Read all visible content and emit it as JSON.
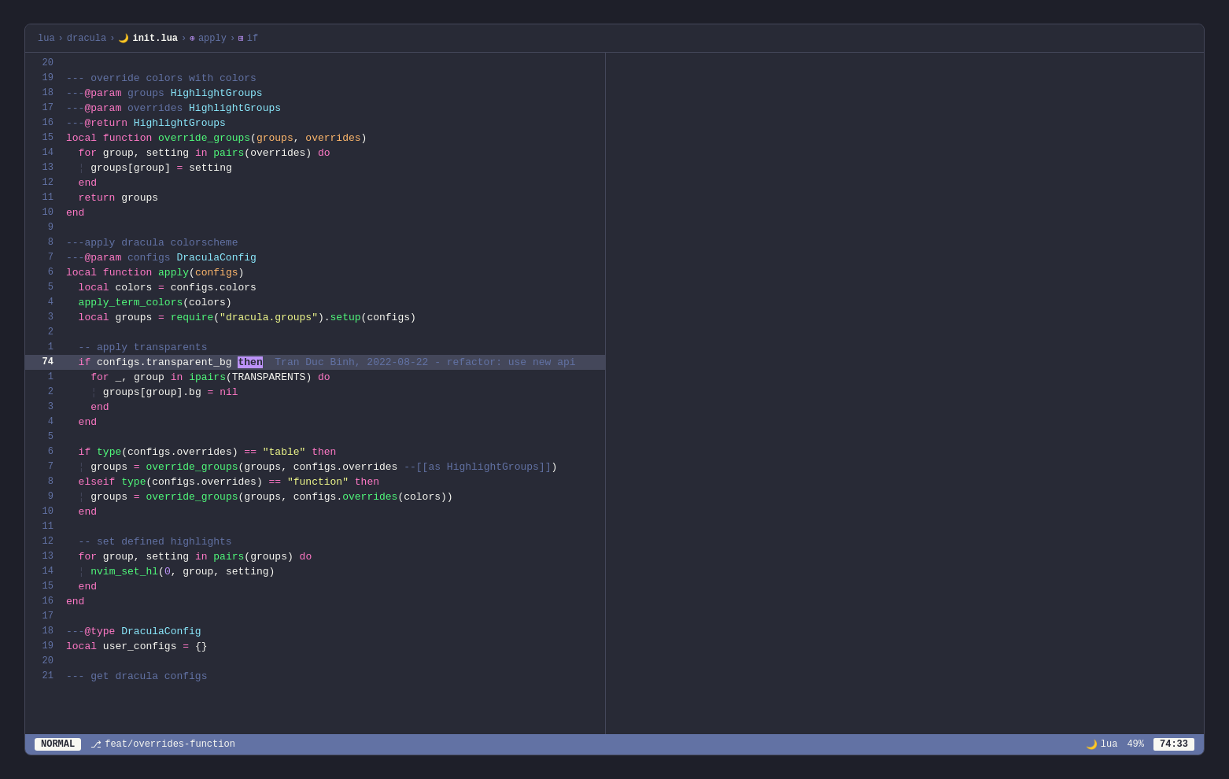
{
  "breadcrumb": {
    "parts": [
      "lua",
      "dracula",
      "init.lua",
      "apply",
      "if"
    ],
    "icons": [
      "",
      "🌙",
      "",
      "⊕",
      ""
    ]
  },
  "statusbar": {
    "mode": "NORMAL",
    "branch_icon": "⎇",
    "branch": "feat/overrides-function",
    "filename": "init.lua",
    "lang_icon": "🌙",
    "lang": "lua",
    "percent": "49%",
    "position": "74:33"
  },
  "lines": [
    {
      "num": "20",
      "content": ""
    },
    {
      "num": "19",
      "content": "--- override colors with colors"
    },
    {
      "num": "18",
      "content": "---@param groups HighlightGroups"
    },
    {
      "num": "17",
      "content": "---@param overrides HighlightGroups"
    },
    {
      "num": "16",
      "content": "---@return HighlightGroups"
    },
    {
      "num": "15",
      "content": "local function override_groups(groups, overrides)"
    },
    {
      "num": "14",
      "content": "  for group, setting in pairs(overrides) do"
    },
    {
      "num": "13",
      "content": "  ¦ groups[group] = setting"
    },
    {
      "num": "12",
      "content": "  end"
    },
    {
      "num": "11",
      "content": "  return groups"
    },
    {
      "num": "10",
      "content": "end"
    },
    {
      "num": "9",
      "content": ""
    },
    {
      "num": "8",
      "content": "---apply dracula colorscheme"
    },
    {
      "num": "7",
      "content": "---@param configs DraculaConfig"
    },
    {
      "num": "6",
      "content": "local function apply(configs)"
    },
    {
      "num": "5",
      "content": "  local colors = configs.colors"
    },
    {
      "num": "4",
      "content": "  apply_term_colors(colors)"
    },
    {
      "num": "3",
      "content": "  local groups = require(\"dracula.groups\").setup(configs)"
    },
    {
      "num": "2",
      "content": ""
    },
    {
      "num": "1",
      "content": "  -- apply transparents"
    },
    {
      "num": "74",
      "content": "  if configs.transparent_bg then  Tran Duc Binh, 2022-08-22 - refactor: use new api",
      "current": true
    },
    {
      "num": "1",
      "content": "    for _, group in ipairs(TRANSPARENTS) do"
    },
    {
      "num": "2",
      "content": "    ¦ groups[group].bg = nil"
    },
    {
      "num": "3",
      "content": "    end"
    },
    {
      "num": "4",
      "content": "  end"
    },
    {
      "num": "5",
      "content": ""
    },
    {
      "num": "6",
      "content": "  if type(configs.overrides) == \"table\" then"
    },
    {
      "num": "7",
      "content": "  ¦ groups = override_groups(groups, configs.overrides --[[as HighlightGroups]])"
    },
    {
      "num": "8",
      "content": "  elseif type(configs.overrides) == \"function\" then"
    },
    {
      "num": "9",
      "content": "  ¦ groups = override_groups(groups, configs.overrides(colors))"
    },
    {
      "num": "10",
      "content": "  end"
    },
    {
      "num": "11",
      "content": ""
    },
    {
      "num": "12",
      "content": "  -- set defined highlights"
    },
    {
      "num": "13",
      "content": "  for group, setting in pairs(groups) do"
    },
    {
      "num": "14",
      "content": "  ¦ nvim_set_hl(0, group, setting)"
    },
    {
      "num": "15",
      "content": "  end"
    },
    {
      "num": "16",
      "content": "end"
    },
    {
      "num": "17",
      "content": ""
    },
    {
      "num": "18",
      "content": "---@type DraculaConfig"
    },
    {
      "num": "19",
      "content": "local user_configs = {}"
    },
    {
      "num": "20",
      "content": ""
    },
    {
      "num": "21",
      "content": "--- get dracula configs"
    }
  ]
}
